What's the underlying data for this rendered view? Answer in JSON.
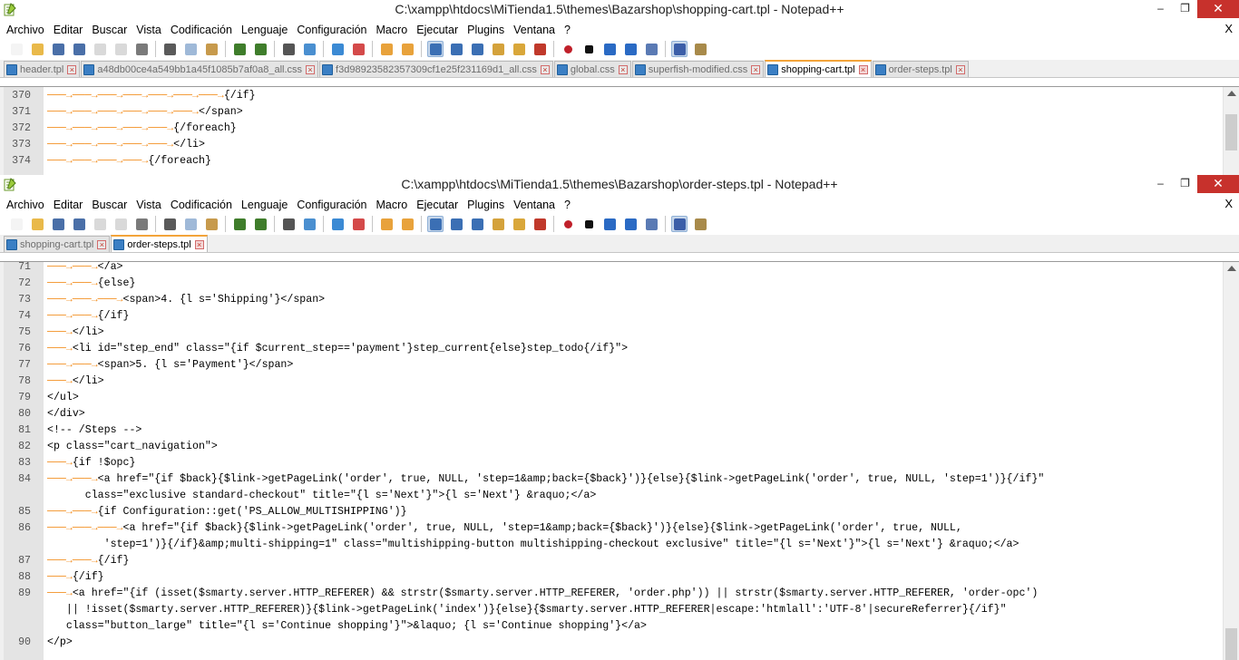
{
  "window1": {
    "title": "C:\\xampp\\htdocs\\MiTienda1.5\\themes\\Bazarshop\\shopping-cart.tpl - Notepad++",
    "min_glyph": "–",
    "max_glyph": "❐",
    "close_glyph": "✕",
    "menu": [
      "Archivo",
      "Editar",
      "Buscar",
      "Vista",
      "Codificación",
      "Lenguaje",
      "Configuración",
      "Macro",
      "Ejecutar",
      "Plugins",
      "Ventana",
      "?"
    ],
    "menu_close": "X",
    "tabs": [
      {
        "label": "header.tpl",
        "active": false
      },
      {
        "label": "a48db00ce4a549bb1a45f1085b7af0a8_all.css",
        "active": false
      },
      {
        "label": "f3d98923582357309cf1e25f231169d1_all.css",
        "active": false
      },
      {
        "label": "global.css",
        "active": false
      },
      {
        "label": "superfish-modified.css",
        "active": false
      },
      {
        "label": "shopping-cart.tpl",
        "active": true
      },
      {
        "label": "order-steps.tpl",
        "active": false
      }
    ],
    "lines": [
      {
        "n": "370",
        "indent": 7,
        "text": "{/if}"
      },
      {
        "n": "371",
        "indent": 6,
        "text": "</span>"
      },
      {
        "n": "372",
        "indent": 5,
        "text": "{/foreach}"
      },
      {
        "n": "373",
        "indent": 5,
        "text": "</li>"
      },
      {
        "n": "374",
        "indent": 4,
        "text": "{/foreach}"
      }
    ]
  },
  "window2": {
    "title": "C:\\xampp\\htdocs\\MiTienda1.5\\themes\\Bazarshop\\order-steps.tpl - Notepad++",
    "min_glyph": "–",
    "max_glyph": "❐",
    "close_glyph": "✕",
    "menu": [
      "Archivo",
      "Editar",
      "Buscar",
      "Vista",
      "Codificación",
      "Lenguaje",
      "Configuración",
      "Macro",
      "Ejecutar",
      "Plugins",
      "Ventana",
      "?"
    ],
    "menu_close": "X",
    "tabs": [
      {
        "label": "shopping-cart.tpl",
        "active": false
      },
      {
        "label": "order-steps.tpl",
        "active": true
      }
    ],
    "lines": [
      {
        "n": "71",
        "indent": 2,
        "text": "</a>"
      },
      {
        "n": "72",
        "indent": 2,
        "text": "{else}"
      },
      {
        "n": "73",
        "indent": 3,
        "text": "<span>4. {l s='Shipping'}</span>"
      },
      {
        "n": "74",
        "indent": 2,
        "text": "{/if}"
      },
      {
        "n": "75",
        "indent": 1,
        "text": "</li>"
      },
      {
        "n": "76",
        "indent": 1,
        "text": "<li id=\"step_end\" class=\"{if $current_step=='payment'}step_current{else}step_todo{/if}\">"
      },
      {
        "n": "77",
        "indent": 2,
        "text": "<span>5. {l s='Payment'}</span>"
      },
      {
        "n": "78",
        "indent": 1,
        "text": "</li>"
      },
      {
        "n": "79",
        "indent": 0,
        "text": "</ul>"
      },
      {
        "n": "80",
        "indent": 0,
        "text": "</div>"
      },
      {
        "n": "81",
        "indent": 0,
        "text": "<!-- /Steps -->"
      },
      {
        "n": "82",
        "indent": 0,
        "text": "<p class=\"cart_navigation\">"
      },
      {
        "n": "83",
        "indent": 1,
        "text": "{if !$opc}"
      },
      {
        "n": "84",
        "indent": 2,
        "text": "<a href=\"{if $back}{$link->getPageLink('order', true, NULL, 'step=1&amp;back={$back}')}{else}{$link->getPageLink('order', true, NULL, 'step=1')}{/if}\""
      },
      {
        "n": "",
        "indent": 0,
        "pad": "      ",
        "text": "class=\"exclusive standard-checkout\" title=\"{l s='Next'}\">{l s='Next'} &raquo;</a>"
      },
      {
        "n": "85",
        "indent": 2,
        "text": "{if Configuration::get('PS_ALLOW_MULTISHIPPING')}"
      },
      {
        "n": "86",
        "indent": 3,
        "text": "<a href=\"{if $back}{$link->getPageLink('order', true, NULL, 'step=1&amp;back={$back}')}{else}{$link->getPageLink('order', true, NULL,"
      },
      {
        "n": "",
        "indent": 0,
        "pad": "         ",
        "text": "'step=1')}{/if}&amp;multi-shipping=1\" class=\"multishipping-button multishipping-checkout exclusive\" title=\"{l s='Next'}\">{l s='Next'} &raquo;</a>"
      },
      {
        "n": "87",
        "indent": 2,
        "text": "{/if}"
      },
      {
        "n": "88",
        "indent": 1,
        "text": "{/if}"
      },
      {
        "n": "89",
        "indent": 1,
        "text": "<a href=\"{if (isset($smarty.server.HTTP_REFERER) && strstr($smarty.server.HTTP_REFERER, 'order.php')) || strstr($smarty.server.HTTP_REFERER, 'order-opc')"
      },
      {
        "n": "",
        "indent": 0,
        "pad": "   ",
        "text": "|| !isset($smarty.server.HTTP_REFERER)}{$link->getPageLink('index')}{else}{$smarty.server.HTTP_REFERER|escape:'htmlall':'UTF-8'|secureReferrer}{/if}\""
      },
      {
        "n": "",
        "indent": 0,
        "pad": "   ",
        "text": "class=\"button_large\" title=\"{l s='Continue shopping'}\">&laquo; {l s='Continue shopping'}</a>"
      },
      {
        "n": "90",
        "indent": 0,
        "text": "</p>"
      }
    ]
  },
  "toolbar_icons": [
    "new-icon",
    "open-icon",
    "save-icon",
    "save-all-icon",
    "close-icon",
    "close-all-icon",
    "print-icon",
    "|",
    "cut-icon",
    "copy-icon",
    "paste-icon",
    "|",
    "undo-icon",
    "redo-icon",
    "|",
    "find-icon",
    "replace-icon",
    "|",
    "zoom-in-icon",
    "zoom-out-icon",
    "|",
    "sync-v-icon",
    "sync-h-icon",
    "|",
    "wrap-icon",
    "all-chars-icon",
    "indent-guide-icon",
    "udl-icon",
    "doc-map-icon",
    "function-list-icon",
    "|",
    "record-macro-icon",
    "stop-macro-icon",
    "play-macro-icon",
    "run-macro-multiple-icon",
    "save-macro-icon",
    "|",
    "spellcheck-icon",
    "launch-icon"
  ],
  "colors": {
    "tab_accent": "#f3a43a",
    "close_red": "#c7312c",
    "indent_arrow": "#f28a18",
    "gutter": "#e4e4e4",
    "tab_icon": "#3b7fc4"
  }
}
